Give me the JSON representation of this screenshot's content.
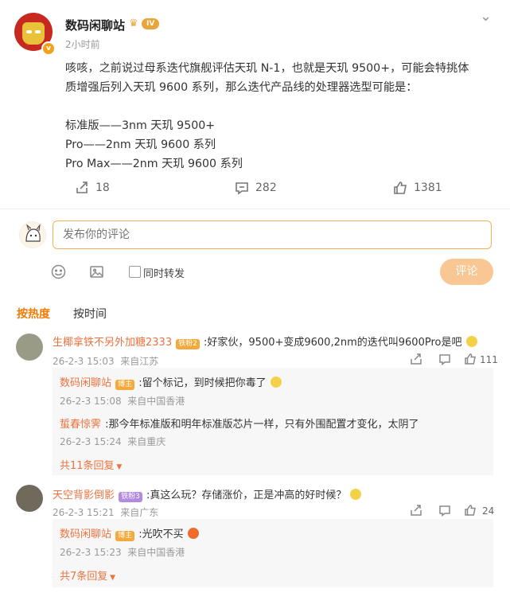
{
  "post": {
    "author": "数码闲聊站",
    "level_badge": "IV",
    "time": "2小时前",
    "lines": [
      "咳咳，之前说过母系迭代旗舰评估天玑 N-1，也就是天玑 9500+，可能会特挑体",
      "质增强后列入天玑 9600 系列，那么迭代产品线的处理器选型可能是：",
      "标准版——3nm 天玑 9500+",
      "Pro——2nm 天玑 9600 系列",
      "Pro Max——2nm 天玑 9600 系列"
    ],
    "reposts": "18",
    "comments": "282",
    "likes": "1381"
  },
  "composer": {
    "placeholder": "发布你的评论",
    "repost_label": "同时转发",
    "submit_label": "评论"
  },
  "sort": {
    "hot": "按热度",
    "time": "按时间"
  },
  "comments": [
    {
      "user": "生椰拿铁不另外加糖2333",
      "badge": "铁粉2",
      "text": ":好家伙，9500+变成9600,2nm的迭代叫9600Pro是吧",
      "date": "26-2-3 15:03",
      "location": "来自江苏",
      "likes": "111",
      "replies": [
        {
          "user": "数码闲聊站",
          "badge": "博主",
          "text": ":留个标记，到时候把你毒了",
          "date": "26-2-3 15:08",
          "location": "来自中国香港"
        },
        {
          "user": "蜇春惊霁",
          "badge": "",
          "text": ":那今年标准版和明年标准版芯片一样，只有外围配置才变化，太阴了",
          "date": "26-2-3 15:24",
          "location": "来自重庆"
        }
      ],
      "more_replies": "共11条回复"
    },
    {
      "user": "天空背影倒影",
      "badge": "铁粉3",
      "text": ":真这么玩？存储涨价，正是冲高的好时候？",
      "date": "26-2-3 15:21",
      "location": "来自广东",
      "likes": "24",
      "replies": [
        {
          "user": "数码闲聊站",
          "badge": "博主",
          "text": ":光吹不买",
          "date": "26-2-3 15:23",
          "location": "来自中国香港"
        }
      ],
      "more_replies": "共7条回复"
    }
  ],
  "colors": {
    "accent": "#f27c00",
    "username": "#eb7340",
    "submit_disabled": "#f8c794"
  }
}
